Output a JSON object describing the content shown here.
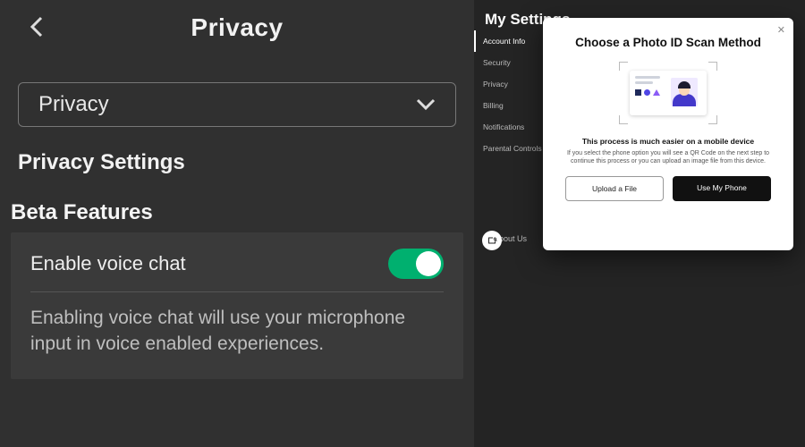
{
  "left": {
    "header_title": "Privacy",
    "dropdown_label": "Privacy",
    "section_title": "Privacy Settings",
    "beta_title": "Beta Features",
    "voice_chat": {
      "label": "Enable voice chat",
      "enabled": true,
      "description": "Enabling voice chat will use your microphone input in voice enabled experiences."
    }
  },
  "right": {
    "title": "My Settings",
    "sidebar": [
      {
        "label": "Account Info",
        "active": true
      },
      {
        "label": "Security",
        "active": false
      },
      {
        "label": "Privacy",
        "active": false
      },
      {
        "label": "Billing",
        "active": false
      },
      {
        "label": "Notifications",
        "active": false
      },
      {
        "label": "Parental Controls",
        "active": false
      }
    ],
    "footer": [
      "About Us",
      ""
    ]
  },
  "modal": {
    "title": "Choose a Photo ID Scan Method",
    "bold_line": "This process is much easier on a mobile device",
    "sub_line": "If you select the phone option you will see a QR Code on the next step to continue this process or you can upload an image file from this device.",
    "upload_btn": "Upload a File",
    "phone_btn": "Use My Phone",
    "close_glyph": "✕"
  }
}
